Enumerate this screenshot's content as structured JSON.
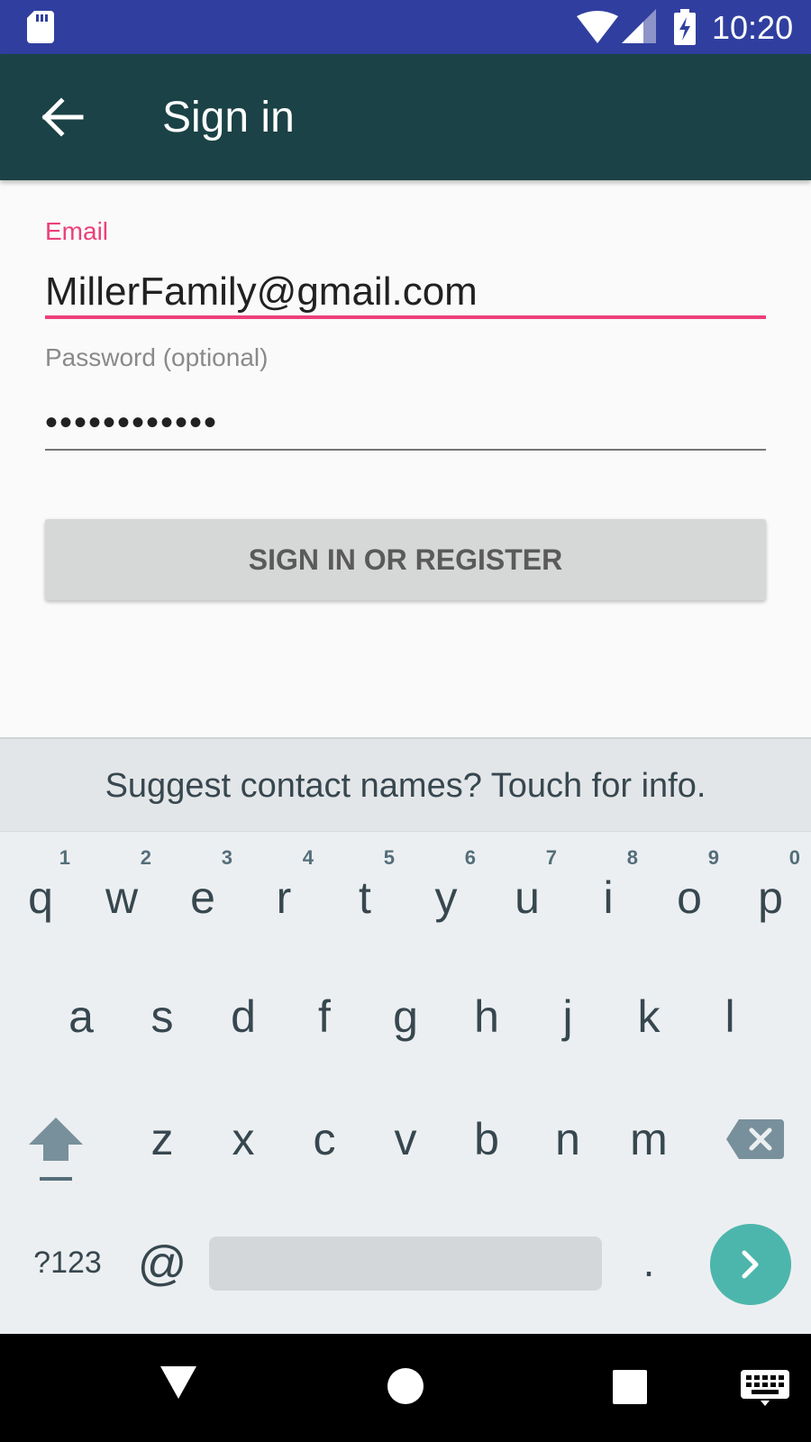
{
  "status_bar": {
    "time": "10:20",
    "icons": [
      "sd-card-icon",
      "wifi-icon",
      "cell-signal-icon",
      "battery-charging-icon"
    ]
  },
  "app_bar": {
    "title": "Sign in",
    "back_icon": "arrow-back-icon"
  },
  "form": {
    "email_label": "Email",
    "email_value": "MillerFamily@gmail.com",
    "password_label": "Password (optional)",
    "password_value": "••••••••••••"
  },
  "primary_button": "SIGN IN OR REGISTER",
  "keyboard": {
    "suggestion": "Suggest contact names? Touch for info.",
    "row1": [
      {
        "ch": "q",
        "num": "1"
      },
      {
        "ch": "w",
        "num": "2"
      },
      {
        "ch": "e",
        "num": "3"
      },
      {
        "ch": "r",
        "num": "4"
      },
      {
        "ch": "t",
        "num": "5"
      },
      {
        "ch": "y",
        "num": "6"
      },
      {
        "ch": "u",
        "num": "7"
      },
      {
        "ch": "i",
        "num": "8"
      },
      {
        "ch": "o",
        "num": "9"
      },
      {
        "ch": "p",
        "num": "0"
      }
    ],
    "row2": [
      "a",
      "s",
      "d",
      "f",
      "g",
      "h",
      "j",
      "k",
      "l"
    ],
    "row3": [
      "z",
      "x",
      "c",
      "v",
      "b",
      "n",
      "m"
    ],
    "symbols_label": "?123",
    "at_label": "@",
    "period_label": ".",
    "icons": [
      "shift-icon",
      "backspace-icon",
      "enter-next-icon"
    ]
  },
  "nav_bar": {
    "icons": [
      "back-triangle-icon",
      "home-circle-icon",
      "recents-square-icon",
      "keyboard-switch-icon"
    ]
  },
  "colors": {
    "status_bar": "#303f9f",
    "app_bar": "#1b4246",
    "accent": "#ec407a",
    "enter_key": "#4db6ac"
  }
}
